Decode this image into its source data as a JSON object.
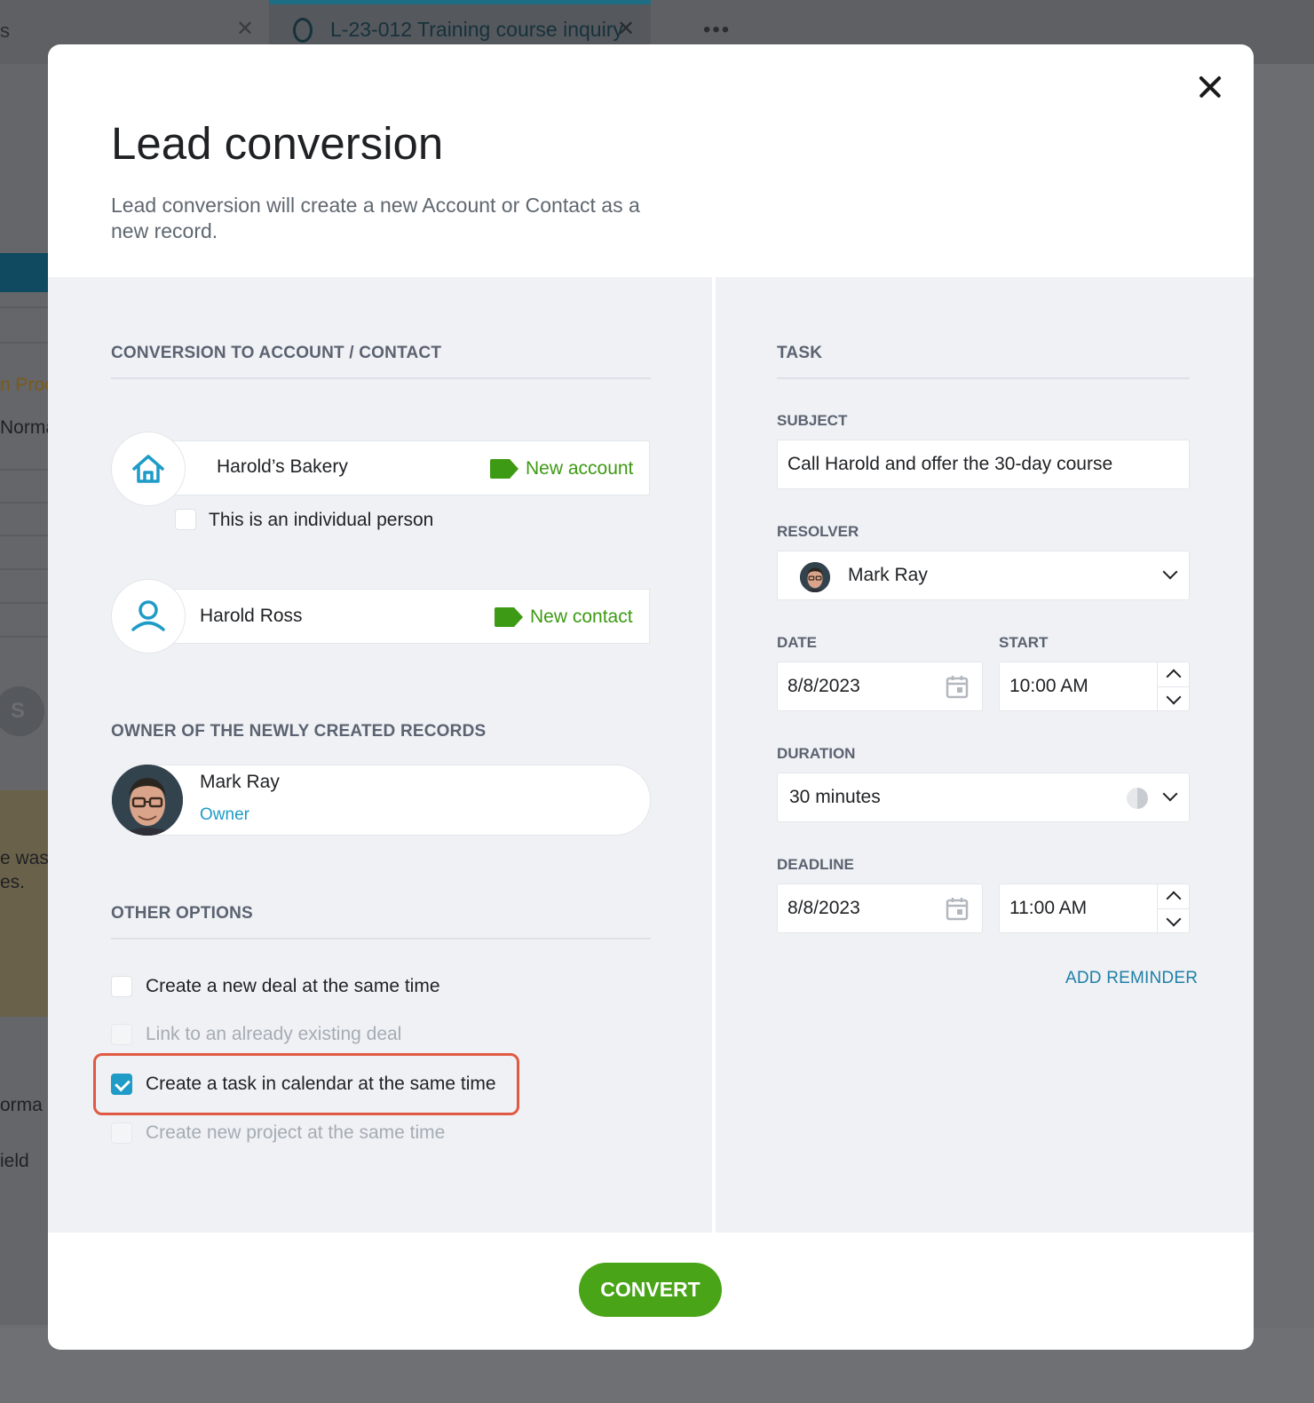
{
  "background": {
    "tab_label": "L-23-012 Training course inquiry",
    "tab_close": "✕",
    "prev_tab_close": "✕",
    "overflow_dots": "•••",
    "left_fragments": [
      "s",
      "n Proc",
      "Norma",
      "e was",
      "es.",
      "orma",
      "ield"
    ]
  },
  "modal": {
    "title": "Lead conversion",
    "subtitle": "Lead conversion will create a new Account or Contact as a new record.",
    "close_icon": "close-icon"
  },
  "conversion": {
    "section_title": "CONVERSION TO ACCOUNT / CONTACT",
    "account": {
      "name": "Harold’s Bakery",
      "badge": "New account",
      "icon": "home-icon"
    },
    "individual_checkbox": {
      "label": "This is an individual person",
      "checked": false
    },
    "contact": {
      "name": "Harold Ross",
      "badge": "New contact",
      "icon": "person-icon"
    }
  },
  "owner": {
    "section_title": "OWNER OF THE NEWLY CREATED RECORDS",
    "name": "Mark Ray",
    "role": "Owner"
  },
  "other_options": {
    "section_title": "OTHER OPTIONS",
    "items": [
      {
        "label": "Create a new deal at the same time",
        "checked": false,
        "disabled": false
      },
      {
        "label": "Link to an already existing deal",
        "checked": false,
        "disabled": true
      },
      {
        "label": "Create a task in calendar at the same time",
        "checked": true,
        "disabled": false
      },
      {
        "label": "Create new project at the same time",
        "checked": false,
        "disabled": true
      }
    ]
  },
  "task": {
    "section_title": "TASK",
    "subject_label": "SUBJECT",
    "subject_value": "Call Harold and offer the 30-day course",
    "resolver_label": "RESOLVER",
    "resolver_value": "Mark Ray",
    "date_label": "DATE",
    "date_value": "8/8/2023",
    "start_label": "START",
    "start_value": "10:00 AM",
    "duration_label": "DURATION",
    "duration_value": "30 minutes",
    "deadline_label": "DEADLINE",
    "deadline_date": "8/8/2023",
    "deadline_time": "11:00 AM",
    "add_reminder": "ADD REMINDER"
  },
  "convert_button": "CONVERT",
  "colors": {
    "accent_green": "#49a418",
    "badge_green": "#3d9a14",
    "accent_blue": "#1e9bc7",
    "highlight_red": "#e05a43"
  }
}
